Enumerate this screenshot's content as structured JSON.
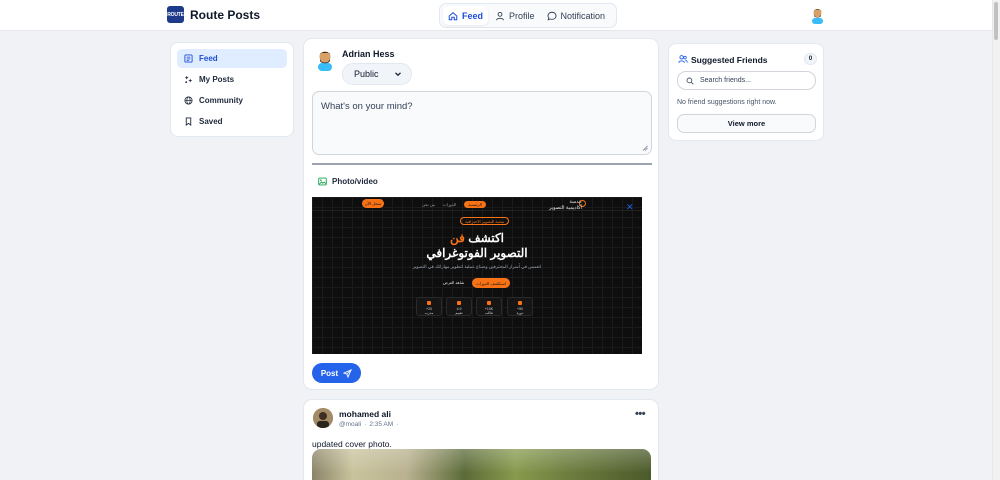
{
  "header": {
    "logo_text": "ROUTE",
    "brand": "Route Posts",
    "tabs": [
      {
        "label": "Feed",
        "icon": "home-icon",
        "active": true
      },
      {
        "label": "Profile",
        "icon": "user-icon",
        "active": false
      },
      {
        "label": "Notification",
        "icon": "chat-bubble-icon",
        "active": false
      }
    ]
  },
  "sidebar": {
    "items": [
      {
        "label": "Feed",
        "icon": "feed-icon",
        "active": true
      },
      {
        "label": "My Posts",
        "icon": "sparkle-icon",
        "active": false
      },
      {
        "label": "Community",
        "icon": "globe-icon",
        "active": false
      },
      {
        "label": "Saved",
        "icon": "bookmark-icon",
        "active": false
      }
    ]
  },
  "composer": {
    "user_name": "Adrian Hess",
    "privacy": "Public",
    "text_value": "What's on your mind?",
    "photo_label": "Photo/video",
    "post_label": "Post",
    "preview": {
      "brand_line1": "عدسة",
      "brand_line2": "أكاديمية التصوير",
      "nav_items": [
        "الرئيسية",
        "الدورات",
        "من نحن"
      ],
      "cta": "سجل الآن",
      "badge": "منصة التصوير الاحترافية",
      "headline_pre": "اكتشف ",
      "headline_accent": "فن",
      "headline_line2": "التصوير الفوتوغرافي",
      "subtitle": "انغمس في أسرار المحترفين وصناع عملية لتطوير مهاراتك في التصوير",
      "btn_primary": "استكشف الدورات",
      "btn_secondary": "شاهد العرض",
      "stats": [
        {
          "value": "+50",
          "label": "دورة"
        },
        {
          "value": "+10K",
          "label": "طالب"
        },
        {
          "value": "4.9",
          "label": "تقييم"
        },
        {
          "value": "+20",
          "label": "مدرب"
        }
      ]
    }
  },
  "friends": {
    "title": "Suggested Friends",
    "count": "0",
    "search_placeholder": "Search friends...",
    "empty_text": "No friend suggestions right now.",
    "view_more": "View more"
  },
  "post2": {
    "author": "mohamed ali",
    "handle": "@moali",
    "separator": "·",
    "time": "2:35 AM",
    "audience_icon": "·",
    "text": "updated cover photo."
  },
  "colors": {
    "accent": "#2563eb",
    "brand_dark": "#1e3a8a",
    "preview_orange": "#f97316"
  }
}
